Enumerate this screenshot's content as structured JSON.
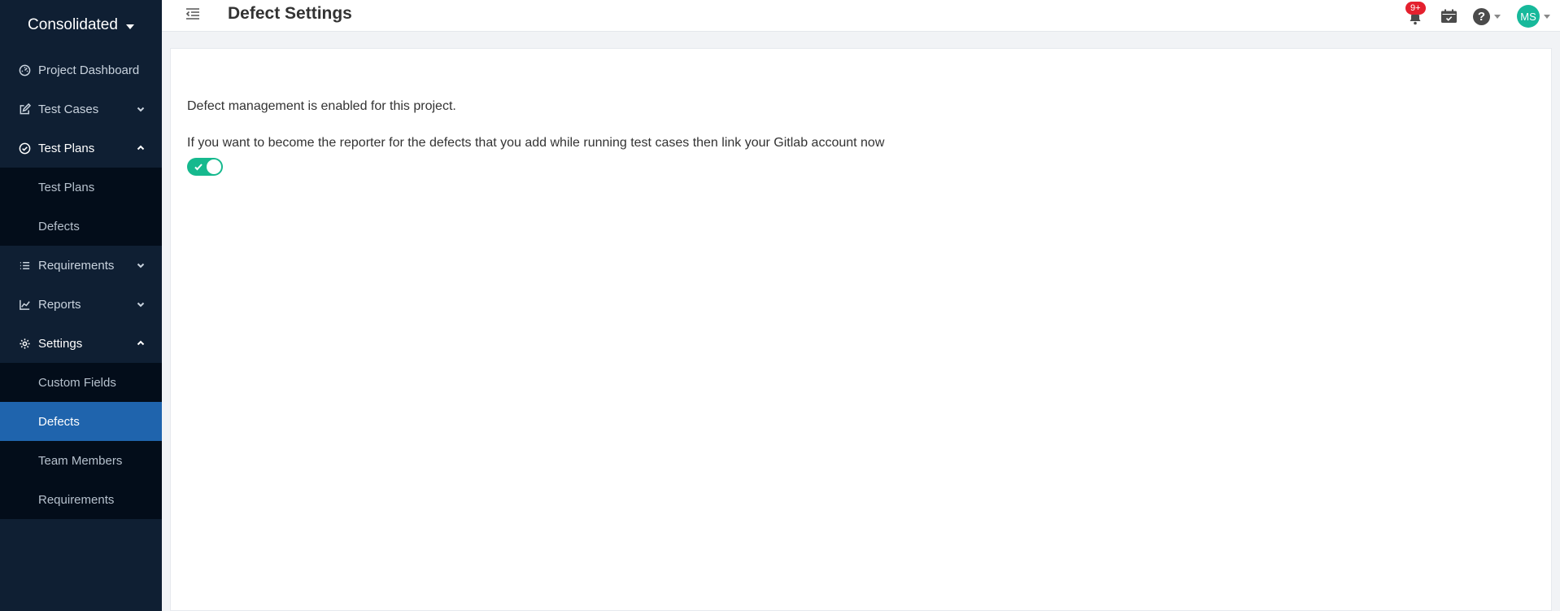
{
  "sidebar": {
    "brand": "Consolidated",
    "items": [
      {
        "label": "Project Dashboard"
      },
      {
        "label": "Test Cases"
      },
      {
        "label": "Test Plans",
        "children": [
          {
            "label": "Test Plans"
          },
          {
            "label": "Defects"
          }
        ]
      },
      {
        "label": "Requirements"
      },
      {
        "label": "Reports"
      },
      {
        "label": "Settings",
        "children": [
          {
            "label": "Custom Fields"
          },
          {
            "label": "Defects"
          },
          {
            "label": "Team Members"
          },
          {
            "label": "Requirements"
          }
        ]
      }
    ]
  },
  "header": {
    "title": "Defect Settings",
    "notification_count": "9+",
    "help_symbol": "?",
    "user_initials": "MS"
  },
  "content": {
    "status_text": "Defect management is enabled for this project.",
    "link_prompt": "If you want to become the reporter for the defects that you add while running test cases then link your Gitlab account now",
    "toggle_on": true
  },
  "colors": {
    "sidebar_bg": "#0f1f33",
    "subnav_bg": "#030d1a",
    "active_item": "#1f64ad",
    "toggle_on": "#16b98e",
    "badge": "#e4202e",
    "avatar": "#17b99b"
  }
}
